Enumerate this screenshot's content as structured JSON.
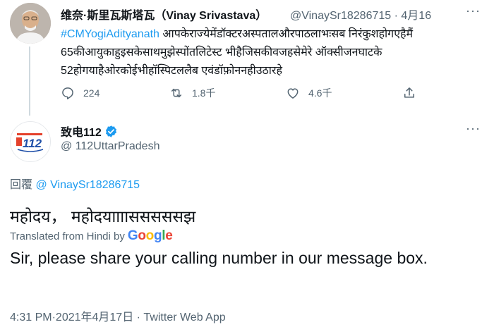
{
  "parent_tweet": {
    "display_name": "维奈·斯里瓦斯塔瓦（Vinay Srivastava）",
    "handle": "@VinaySr18286715",
    "date": "· 4月16",
    "more_glyph": "···",
    "hashtag": "#CMYogiAdityanath",
    "text": " आपकेराज्येमेंडॉक्टरअस्पतालऔरपाठलाभःसब निरंकुशहोगएहैमैं 65कीआयुकाहुइसकेसाथमुझेस्पोंतलिटेस्ट भीहैजिसकीवजहसेमेरे ऑक्सीजनघाटके 52होगयाहैओरकोईभीहॉस्पिटललैब एवंडॉफ़ोननहीउठारहे",
    "replies": "224",
    "retweets": "1.8千",
    "likes": "4.6千"
  },
  "main_tweet": {
    "display_name": "致电112",
    "handle": "@ 112UttarPradesh",
    "more_glyph": "···",
    "avatar_text": "112",
    "reply_label": "回覆",
    "reply_handle": "@ VinaySr18286715",
    "text": "महोदय， महोदयाााासससससझ",
    "translated_from": "Translated from Hindi by",
    "translator_logo": {
      "letters": [
        "G",
        "o",
        "o",
        "g",
        "l",
        "e"
      ],
      "colors": [
        "#4285F4",
        "#EA4335",
        "#FBBC05",
        "#4285F4",
        "#34A853",
        "#EA4335"
      ]
    },
    "translation": "Sir, please share your calling number in our message box.",
    "meta": "4:31 PM·2021年4月17日 · Twitter Web App"
  },
  "colors": {
    "accent": "#1d9bf0",
    "muted": "#536471",
    "text": "#0f1419"
  }
}
